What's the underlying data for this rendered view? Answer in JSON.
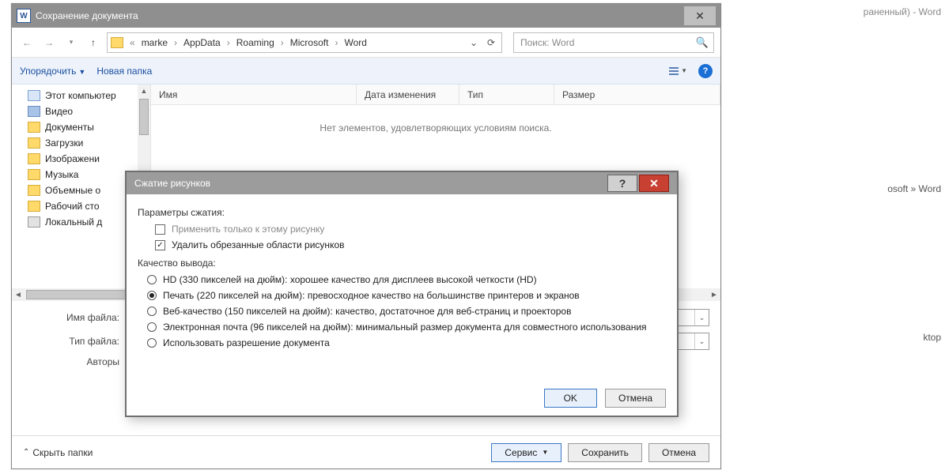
{
  "bg": {
    "title_suffix": "раненный) - Word",
    "path_suffix": "osoft » Word",
    "save_suffix": "ktop"
  },
  "save_dialog": {
    "title": "Сохранение документа",
    "crumbs": [
      "marke",
      "AppData",
      "Roaming",
      "Microsoft",
      "Word"
    ],
    "search_placeholder": "Поиск: Word",
    "cmd_organize": "Упорядочить",
    "cmd_newfolder": "Новая папка",
    "tree": [
      "Этот компьютер",
      "Видео",
      "Документы",
      "Загрузки",
      "Изображени",
      "Музыка",
      "Объемные о",
      "Рабочий сто",
      "Локальный д"
    ],
    "columns": {
      "name": "Имя",
      "date": "Дата изменения",
      "type": "Тип",
      "size": "Размер"
    },
    "empty_msg": "Нет элементов, удовлетворяющих условиям поиска.",
    "filename_label": "Имя файла:",
    "filetype_label": "Тип файла:",
    "authors_label": "Авторы",
    "hide_folders": "Скрыть папки",
    "btn_service": "Сервис",
    "btn_save": "Сохранить",
    "btn_cancel": "Отмена"
  },
  "compress_dialog": {
    "title": "Сжатие рисунков",
    "section_params": "Параметры сжатия:",
    "chk_only_this": "Применить только к этому рисунку",
    "chk_delete_crop": "Удалить обрезанные области рисунков",
    "section_quality": "Качество вывода:",
    "opt_hd": "HD (330 пикселей на дюйм): хорошее качество для дисплеев высокой четкости (HD)",
    "opt_print": "Печать (220 пикселей на дюйм): превосходное качество на большинстве принтеров и экранов",
    "opt_web": "Веб-качество (150 пикселей на дюйм): качество, достаточное для веб-страниц и проекторов",
    "opt_email": "Электронная почта (96 пикселей на дюйм): минимальный размер документа для совместного использования",
    "opt_docres": "Использовать разрешение документа",
    "btn_ok": "OK",
    "btn_cancel": "Отмена"
  }
}
